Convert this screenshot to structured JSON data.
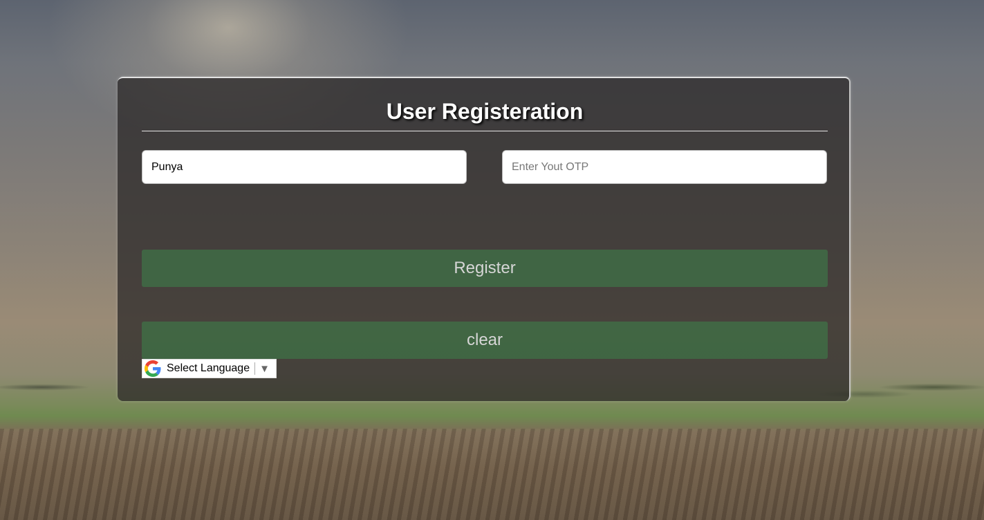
{
  "form": {
    "title": "User Registeration",
    "name_field": {
      "value": "Punya",
      "placeholder": ""
    },
    "otp_field": {
      "value": "",
      "placeholder": "Enter Yout OTP"
    },
    "register_label": "Register",
    "clear_label": "clear"
  },
  "translate": {
    "label": "Select Language",
    "arrow": "▼",
    "icon": "google-g-icon"
  },
  "colors": {
    "card_bg": "#282626",
    "button_bg": "#406e46",
    "button_text": "#d6d6d6",
    "title_text": "#ffffff"
  }
}
